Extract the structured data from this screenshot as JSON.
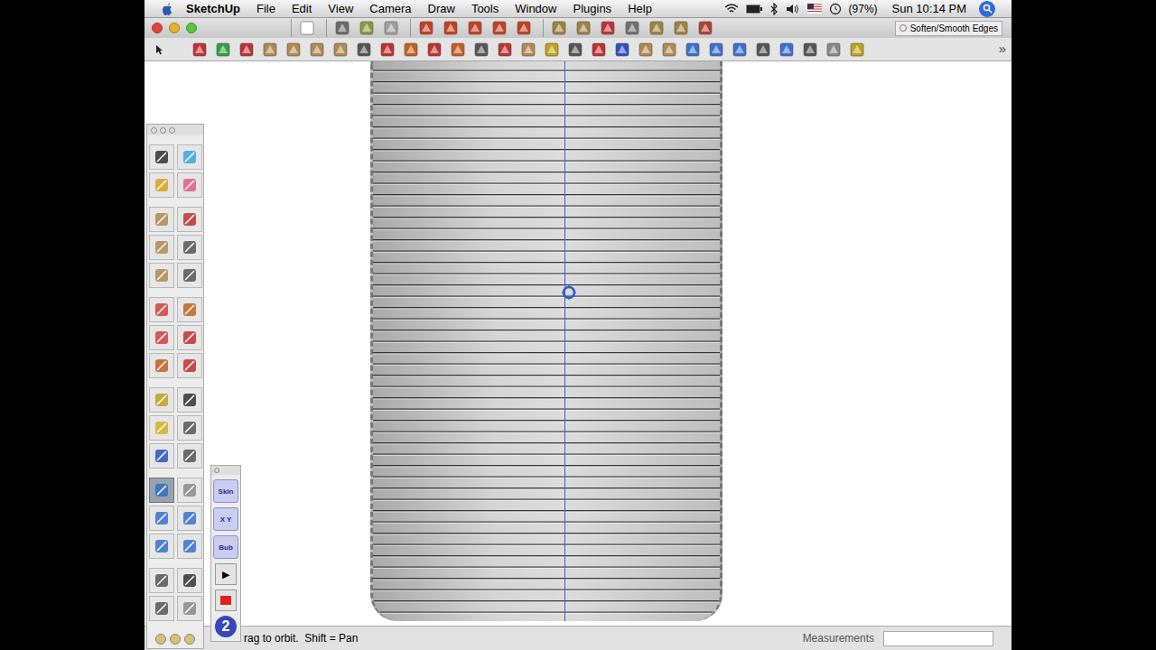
{
  "menu_bar": {
    "items": [
      "SketchUp",
      "File",
      "Edit",
      "View",
      "Camera",
      "Draw",
      "Tools",
      "Window",
      "Plugins",
      "Help"
    ],
    "battery": "(97%)",
    "clock": "Sun 10:14 PM"
  },
  "floating_palette": {
    "label": "Soften/Smooth Edges"
  },
  "toolbar": {
    "overflow": "»"
  },
  "tool_palette": {
    "groups": [
      [
        {
          "selected": false
        },
        {
          "selected": false
        },
        {
          "selected": false
        },
        {
          "selected": false
        }
      ],
      [
        {
          "selected": false
        },
        {
          "selected": false
        },
        {
          "selected": false
        },
        {
          "selected": false
        },
        {
          "selected": false
        },
        {
          "selected": false
        }
      ],
      [
        {
          "selected": false
        },
        {
          "selected": false
        },
        {
          "selected": false
        },
        {
          "selected": false
        },
        {
          "selected": false
        },
        {
          "selected": false
        }
      ],
      [
        {
          "selected": false
        },
        {
          "selected": false
        },
        {
          "selected": false
        },
        {
          "selected": false
        },
        {
          "selected": false
        },
        {
          "selected": false
        }
      ],
      [
        {
          "selected": true
        },
        {
          "selected": false
        },
        {
          "selected": false
        },
        {
          "selected": false
        },
        {
          "selected": false
        },
        {
          "selected": false
        }
      ],
      [
        {
          "selected": false
        },
        {
          "selected": false
        },
        {
          "selected": false
        },
        {
          "selected": false
        }
      ]
    ]
  },
  "plugin_palette": {
    "buttons": [
      {
        "kind": "label",
        "label": "Skin"
      },
      {
        "kind": "label",
        "label": "X Y"
      },
      {
        "kind": "label",
        "label": "Bub"
      },
      {
        "kind": "play",
        "label": "▶"
      },
      {
        "kind": "stop"
      },
      {
        "kind": "logo",
        "label": "2"
      }
    ]
  },
  "status_bar": {
    "hint": "rag to orbit.  Shift = Pan",
    "measurements_label": "Measurements",
    "measurements_value": ""
  }
}
